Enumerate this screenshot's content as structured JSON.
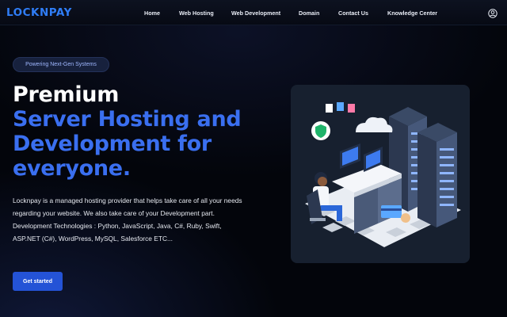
{
  "brand": {
    "logo_text": "LOCKNPAY"
  },
  "nav": {
    "items": [
      {
        "label": "Home"
      },
      {
        "label": "Web Hosting"
      },
      {
        "label": "Web Development"
      },
      {
        "label": "Domain"
      },
      {
        "label": "Contact Us"
      },
      {
        "label": "Knowledge Center"
      }
    ],
    "user_icon": "user-circle-icon"
  },
  "hero": {
    "badge": "Powering Next-Gen Systems",
    "title_line1": "Premium",
    "title_line2": "Server Hosting and",
    "title_line3": "Development for",
    "title_line4": "everyone.",
    "description": "Locknpay is a managed hosting provider that helps take care of all your needs regarding your website. We also take care of your Development part. Development Technologies : Python, JavaScript, Java, C#, Ruby, Swift, ASP.NET (C#), WordPress, MySQL, Salesforce ETC...",
    "cta_label": "Get started"
  },
  "colors": {
    "accent": "#2f7df6",
    "title_blue": "#3a6ff0",
    "button": "#2453d6",
    "background": "#03050b",
    "card": "#17202f"
  },
  "illustration": {
    "icon": "server-room-illustration"
  }
}
